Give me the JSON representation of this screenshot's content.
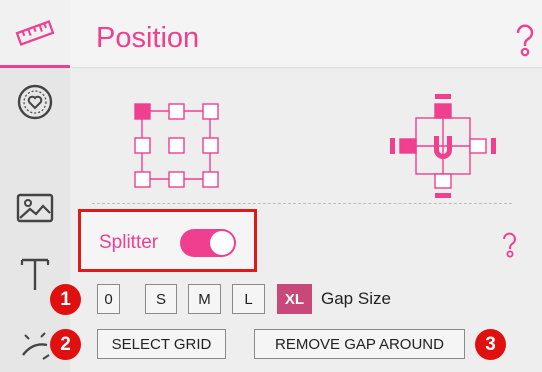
{
  "rail": {
    "icons": [
      "ruler-icon",
      "heart-circle-icon",
      "image-icon",
      "text-icon",
      "wand-icon"
    ]
  },
  "header": {
    "title": "Position",
    "help_icon": "question-icon"
  },
  "splitter": {
    "label": "Splitter",
    "enabled": true
  },
  "gap_size": {
    "options": [
      "0",
      "S",
      "M",
      "L",
      "XL"
    ],
    "selected": "XL",
    "label": "Gap Size"
  },
  "actions": {
    "select_grid": "SELECT GRID",
    "remove_gap_around": "REMOVE GAP AROUND"
  },
  "badges": [
    "1",
    "2",
    "3"
  ],
  "colors": {
    "accent": "#ef3f8e",
    "selected": "#c8487a",
    "highlight": "#e01919"
  }
}
